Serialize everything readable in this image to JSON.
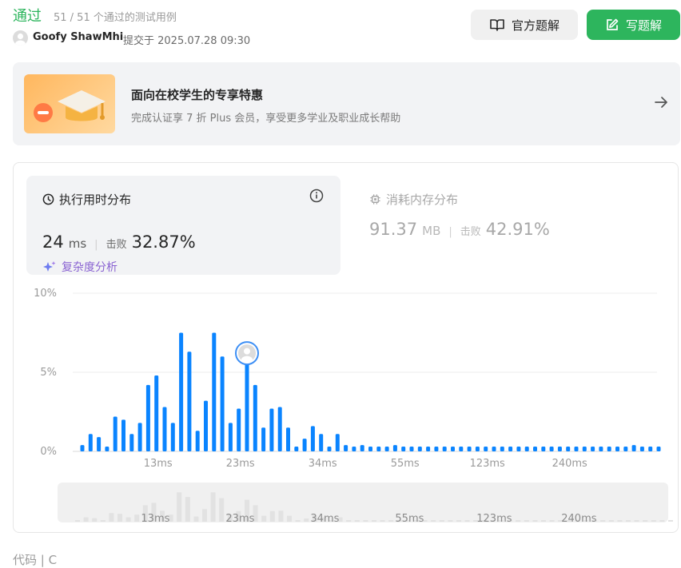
{
  "header": {
    "status": "通过",
    "test_result": "51 / 51 个通过的测试用例",
    "author": "Goofy ShawMhi",
    "submitted": "提交于 2025.07.28 09:30",
    "official_solution_label": "官方题解",
    "write_solution_label": "写题解"
  },
  "promo": {
    "title": "面向在校学生的专享特惠",
    "subtitle": "完成认证享 7 折 Plus 会员，享受更多学业及职业成长帮助"
  },
  "runtime": {
    "title": "执行用时分布",
    "value": "24",
    "unit": "ms",
    "beat_label": "击败",
    "beat": "32.87%",
    "complexity_label": "复杂度分析"
  },
  "memory": {
    "title": "消耗内存分布",
    "value": "91.37",
    "unit": "MB",
    "beat_label": "击败",
    "beat": "42.91%"
  },
  "colors": {
    "accent_green": "#2db55d",
    "bar_blue": "#0a84ff",
    "bar_gray": "#e2e2e2"
  },
  "chart_data": {
    "type": "bar",
    "ylim": [
      0,
      10
    ],
    "y_ticks": [
      "0%",
      "5%",
      "10%"
    ],
    "x_tick_labels": [
      "13ms",
      "23ms",
      "34ms",
      "55ms",
      "123ms",
      "240ms"
    ],
    "values": [
      0.4,
      1.1,
      0.9,
      0.3,
      2.2,
      2.0,
      1.1,
      1.8,
      4.2,
      4.8,
      2.8,
      1.8,
      7.5,
      6.3,
      1.3,
      3.2,
      7.5,
      6.0,
      1.8,
      2.7,
      5.6,
      4.2,
      1.5,
      2.7,
      2.8,
      1.5,
      0.3,
      0.8,
      1.6,
      1.1,
      0.3,
      1.1,
      0.4,
      0.3,
      0.4,
      0.3,
      0.3,
      0.3,
      0.4,
      0.3,
      0.3,
      0.3,
      0.3,
      0.3,
      0.3,
      0.3,
      0.3,
      0.3,
      0.3,
      0.3,
      0.3,
      0.3,
      0.3,
      0.3,
      0.3,
      0.3,
      0.3,
      0.3,
      0.3,
      0.3,
      0.3,
      0.3,
      0.3,
      0.3,
      0.3,
      0.3,
      0.3,
      0.4,
      0.3,
      0.3,
      0.3
    ],
    "highlight_index": 20
  }
}
